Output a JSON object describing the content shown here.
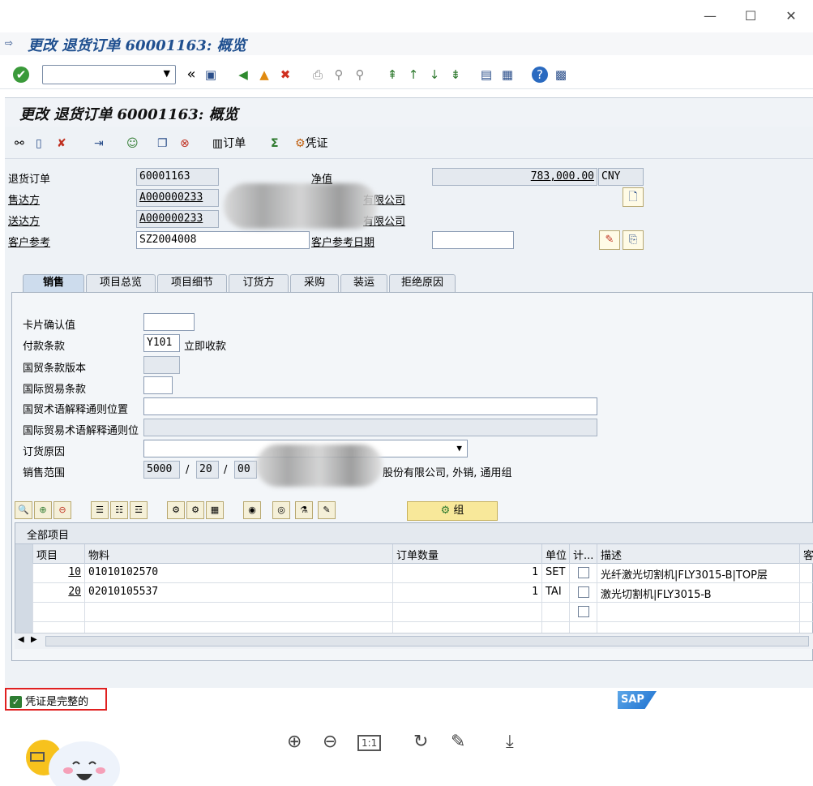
{
  "window": {
    "title": "更改 退货订单 60001163: 概览",
    "min_glyph": "—",
    "max_glyph": "☐",
    "close_glyph": "✕"
  },
  "screen": {
    "title": "更改 退货订单 60001163: 概览"
  },
  "toolbar": {
    "command_placeholder": "",
    "app_buttons": [
      {
        "icon": "display-change-icon"
      },
      {
        "icon": "create-icon"
      },
      {
        "icon": "delete-icon"
      },
      {
        "icon": "import-icon"
      },
      {
        "icon": "partner-icon"
      },
      {
        "icon": "copy-icon"
      },
      {
        "icon": "cancel-icon"
      }
    ],
    "order_label": "订单",
    "voucher_label": "凭证"
  },
  "header": {
    "return_order_label": "退货订单",
    "return_order_value": "60001163",
    "net_value_label": "净值",
    "net_value": "783,000.00",
    "currency": "CNY",
    "sold_to_label": "售达方",
    "sold_to_value": "A000000233",
    "sold_to_name_suffix": "有限公司",
    "ship_to_label": "送达方",
    "ship_to_value": "A000000233",
    "ship_to_name_suffix": "有限公司",
    "customer_ref_label": "客户参考",
    "customer_ref_value": "SZ2004008",
    "customer_ref_date_label": "客户参考日期",
    "customer_ref_date_value": ""
  },
  "tabs": [
    {
      "label": "销售",
      "active": true
    },
    {
      "label": "项目总览",
      "active": false
    },
    {
      "label": "项目细节",
      "active": false
    },
    {
      "label": "订货方",
      "active": false
    },
    {
      "label": "采购",
      "active": false
    },
    {
      "label": "装运",
      "active": false
    },
    {
      "label": "拒绝原因",
      "active": false
    }
  ],
  "sales_tab": {
    "card_confirm_label": "卡片确认值",
    "card_confirm_value": "",
    "payment_terms_label": "付款条款",
    "payment_terms_value": "Y101",
    "payment_terms_desc": "立即收款",
    "incoterms_version_label": "国贸条款版本",
    "incoterms_label": "国际贸易条款",
    "incoterms_location_label": "国贸术语解释通则位置",
    "incoterms_location2_label": "国际贸易术语解释通则位",
    "order_reason_label": "订货原因",
    "order_reason_value": "",
    "sales_area_label": "销售范围",
    "sales_org": "5000",
    "dist_channel": "20",
    "division": "00",
    "sales_area_desc_suffix": "股份有限公司, 外销, 通用组",
    "sep": "/"
  },
  "items_table": {
    "group_button_label": "组",
    "caption": "全部项目",
    "columns": [
      "项目",
      "物料",
      "订单数量",
      "单位",
      "计...",
      "描述",
      "客"
    ],
    "rows": [
      {
        "item": "10",
        "material": "01010102570",
        "qty": "1",
        "unit": "SET",
        "desc": "光纤激光切割机|FLY3015-B|TOP层"
      },
      {
        "item": "20",
        "material": "02010105537",
        "qty": "1",
        "unit": "TAI",
        "desc": "激光切割机|FLY3015-B"
      }
    ]
  },
  "status": {
    "doc_complete_label": "凭证是完整的",
    "sap_logo_text": "SAP"
  },
  "viewer": {
    "ratio_label": "1:1"
  }
}
